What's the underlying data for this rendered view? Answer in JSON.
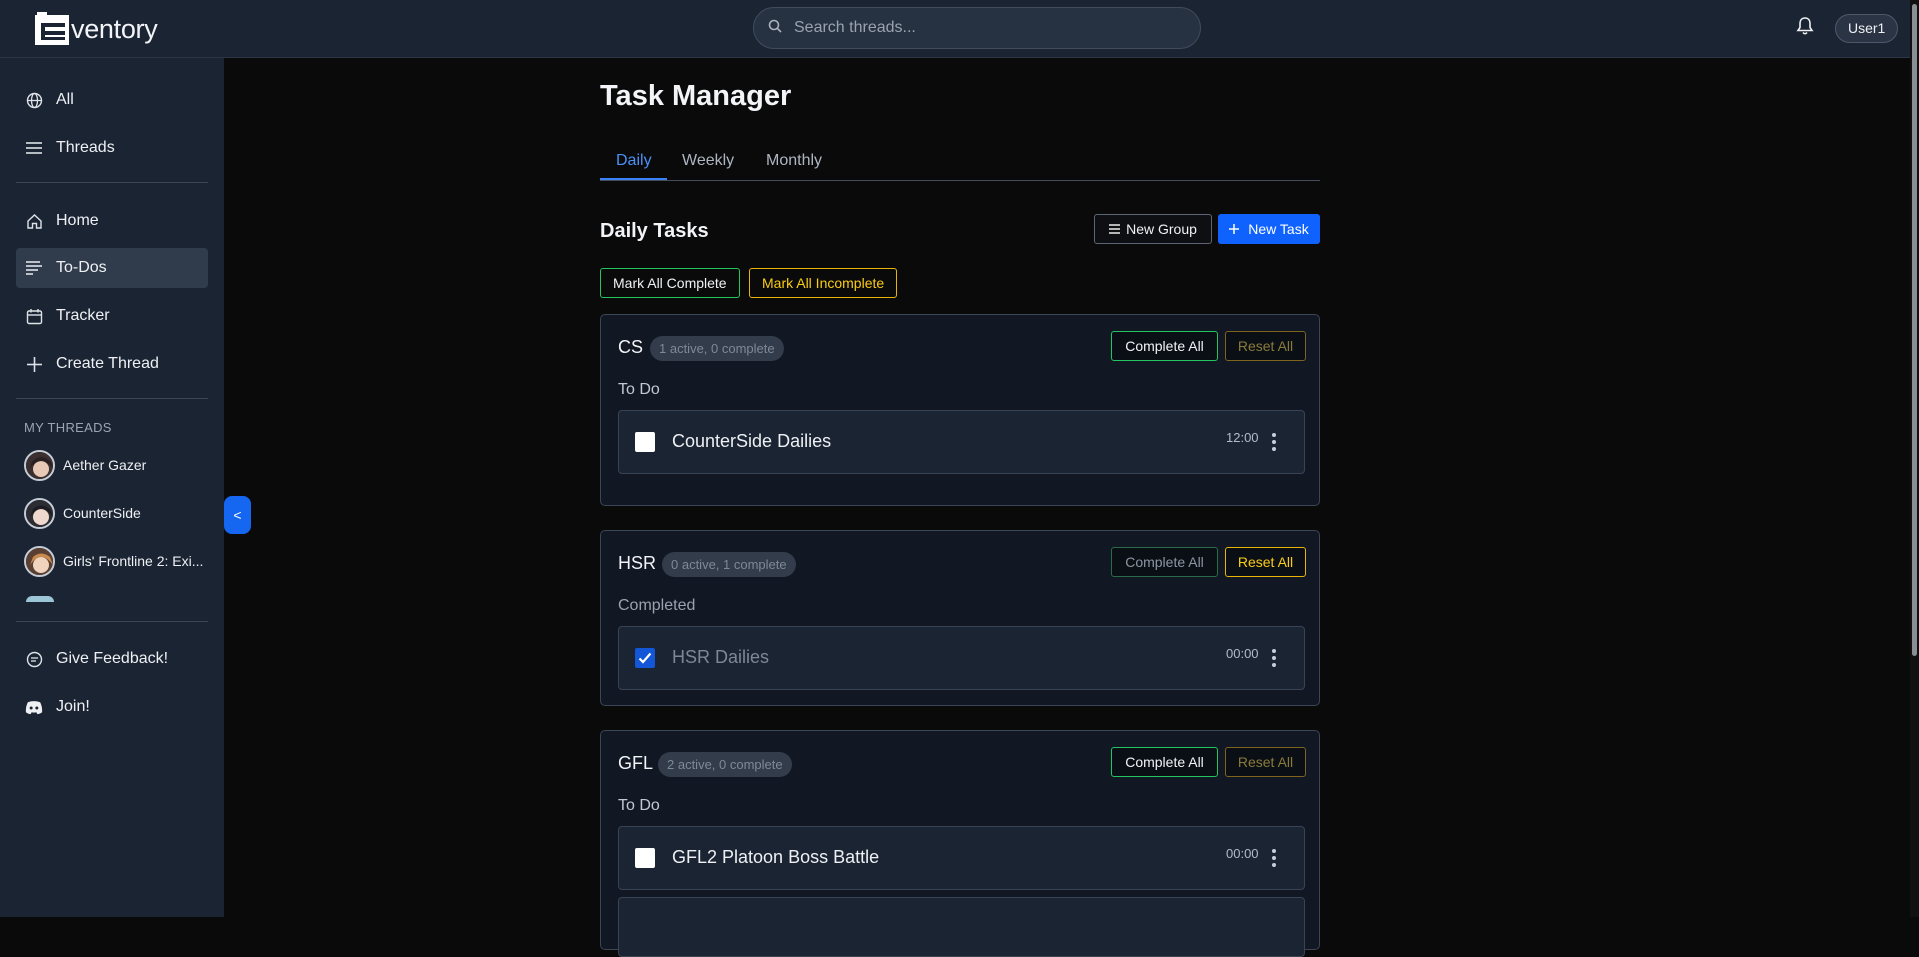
{
  "app": {
    "logo_text": "ventory",
    "user": "User1"
  },
  "search": {
    "placeholder": "Search threads..."
  },
  "sidebar": {
    "top": [
      {
        "label": "All",
        "icon": "globe-icon"
      },
      {
        "label": "Threads",
        "icon": "menu-icon"
      }
    ],
    "nav": [
      {
        "label": "Home",
        "icon": "home-icon"
      },
      {
        "label": "To-Dos",
        "icon": "list-icon"
      },
      {
        "label": "Tracker",
        "icon": "calendar-icon"
      },
      {
        "label": "Create Thread",
        "icon": "plus-icon"
      }
    ],
    "my_threads_label": "MY THREADS",
    "threads": [
      "Aether Gazer",
      "CounterSide",
      "Girls' Frontline 2: Exi..."
    ],
    "bottom": [
      {
        "label": "Give Feedback!",
        "icon": "feedback-icon"
      },
      {
        "label": "Join!",
        "icon": "discord-icon"
      }
    ],
    "collapse_label": "<"
  },
  "main": {
    "title": "Task Manager",
    "tabs": [
      "Daily",
      "Weekly",
      "Monthly"
    ],
    "section_title": "Daily Tasks",
    "new_group": "New Group",
    "new_task": "New Task",
    "mark_all_complete": "Mark All Complete",
    "mark_all_incomplete": "Mark All Incomplete",
    "groups": [
      {
        "name": "CS",
        "badge": "1 active, 0 complete",
        "complete_label": "Complete All",
        "reset_label": "Reset All",
        "status": "To Do",
        "task": {
          "name": "CounterSide Dailies",
          "time": "12:00",
          "done": false
        }
      },
      {
        "name": "HSR",
        "badge": "0 active, 1 complete",
        "complete_label": "Complete All",
        "reset_label": "Reset All",
        "status": "Completed",
        "task": {
          "name": "HSR Dailies",
          "time": "00:00",
          "done": true
        }
      },
      {
        "name": "GFL",
        "badge": "2 active, 0 complete",
        "complete_label": "Complete All",
        "reset_label": "Reset All",
        "status": "To Do",
        "task": {
          "name": "GFL2 Platoon Boss Battle",
          "time": "00:00",
          "done": false
        }
      }
    ]
  },
  "colors": {
    "accent": "#0f62fe",
    "success": "#22c55e",
    "warning": "#eab308",
    "sidebar": "#1b2433"
  }
}
